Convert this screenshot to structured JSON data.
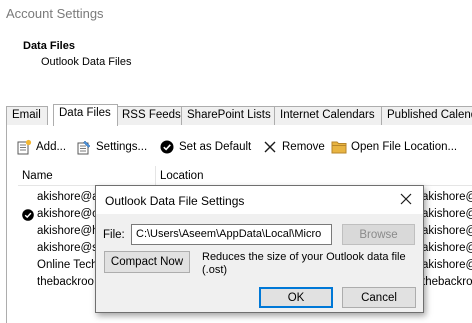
{
  "window": {
    "title": "Account Settings"
  },
  "section": {
    "heading": "Data Files",
    "subheading": "Outlook Data Files"
  },
  "tabs": [
    {
      "label": "Email",
      "active": false
    },
    {
      "label": "Data Files",
      "active": true
    },
    {
      "label": "RSS Feeds",
      "active": false
    },
    {
      "label": "SharePoint Lists",
      "active": false
    },
    {
      "label": "Internet Calendars",
      "active": false
    },
    {
      "label": "Published Calend",
      "active": false
    }
  ],
  "toolbar": {
    "add": {
      "label": "Add...",
      "icon": "add-data-file-icon"
    },
    "settings": {
      "label": "Settings...",
      "icon": "settings-icon"
    },
    "set_default": {
      "label": "Set as Default",
      "icon": "checkmark-circle-icon"
    },
    "remove": {
      "label": "Remove",
      "icon": "remove-x-icon"
    },
    "open_location": {
      "label": "Open File Location...",
      "icon": "folder-icon"
    }
  },
  "list": {
    "columns": [
      "Name",
      "Location"
    ],
    "rows": [
      {
        "name": "akishore@a",
        "location": "akishore@",
        "default": false
      },
      {
        "name": "akishore@c",
        "location": "akishore@",
        "default": true
      },
      {
        "name": "akishore@h",
        "location": "akishore@",
        "default": false
      },
      {
        "name": "akishore@s",
        "location": "akishore@",
        "default": false
      },
      {
        "name": "Online Tech",
        "location": "akishore@",
        "default": false
      },
      {
        "name": "thebackroo",
        "location": "thebackroo",
        "default": false
      }
    ]
  },
  "dialog": {
    "title": "Outlook Data File Settings",
    "file_label": "File:",
    "file_value": "C:\\Users\\Aseem\\AppData\\Local\\Micro",
    "browse_label": "Browse",
    "compact_label": "Compact Now",
    "compact_description": "Reduces the size of your Outlook data file (.ost)",
    "ok_label": "OK",
    "cancel_label": "Cancel"
  },
  "colors": {
    "accent": "#0078d7",
    "set_default_check": "#000000",
    "folder": "#e8b441"
  }
}
